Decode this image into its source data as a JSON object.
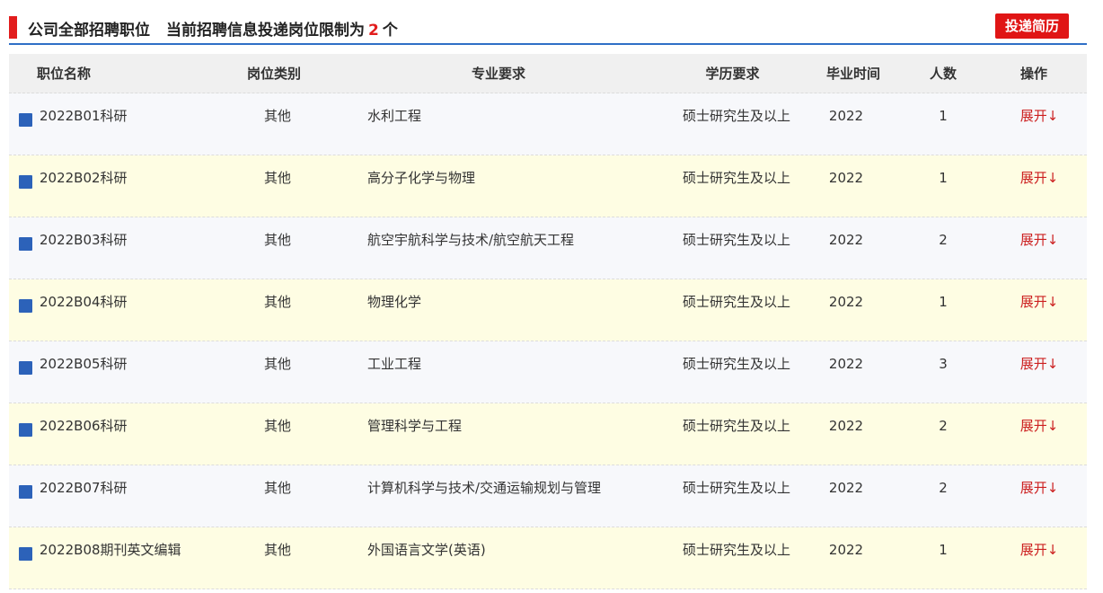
{
  "header": {
    "title": "公司全部招聘职位",
    "limit_prefix": "当前招聘信息投递岗位限制为",
    "limit_number": "2",
    "limit_suffix": "个",
    "submit_label": "投递简历"
  },
  "colors": {
    "accent_red": "#e21d1d",
    "header_rule": "#2f6fc6",
    "row_odd": "#f7f8fb",
    "row_even": "#fefde3",
    "marker_blue": "#2c62b9"
  },
  "columns": [
    "职位名称",
    "岗位类别",
    "专业要求",
    "学历要求",
    "毕业时间",
    "人数",
    "操作"
  ],
  "rows": [
    {
      "name": "2022B01科研",
      "category": "其他",
      "major": "水利工程",
      "degree": "硕士研究生及以上",
      "grad": "2022",
      "count": "1",
      "action": "展开↓"
    },
    {
      "name": "2022B02科研",
      "category": "其他",
      "major": "高分子化学与物理",
      "degree": "硕士研究生及以上",
      "grad": "2022",
      "count": "1",
      "action": "展开↓"
    },
    {
      "name": "2022B03科研",
      "category": "其他",
      "major": "航空宇航科学与技术/航空航天工程",
      "degree": "硕士研究生及以上",
      "grad": "2022",
      "count": "2",
      "action": "展开↓"
    },
    {
      "name": "2022B04科研",
      "category": "其他",
      "major": "物理化学",
      "degree": "硕士研究生及以上",
      "grad": "2022",
      "count": "1",
      "action": "展开↓"
    },
    {
      "name": "2022B05科研",
      "category": "其他",
      "major": "工业工程",
      "degree": "硕士研究生及以上",
      "grad": "2022",
      "count": "3",
      "action": "展开↓"
    },
    {
      "name": "2022B06科研",
      "category": "其他",
      "major": "管理科学与工程",
      "degree": "硕士研究生及以上",
      "grad": "2022",
      "count": "2",
      "action": "展开↓"
    },
    {
      "name": "2022B07科研",
      "category": "其他",
      "major": "计算机科学与技术/交通运输规划与管理",
      "degree": "硕士研究生及以上",
      "grad": "2022",
      "count": "2",
      "action": "展开↓"
    },
    {
      "name": "2022B08期刊英文编辑",
      "category": "其他",
      "major": "外国语言文学(英语)",
      "degree": "硕士研究生及以上",
      "grad": "2022",
      "count": "1",
      "action": "展开↓"
    }
  ]
}
